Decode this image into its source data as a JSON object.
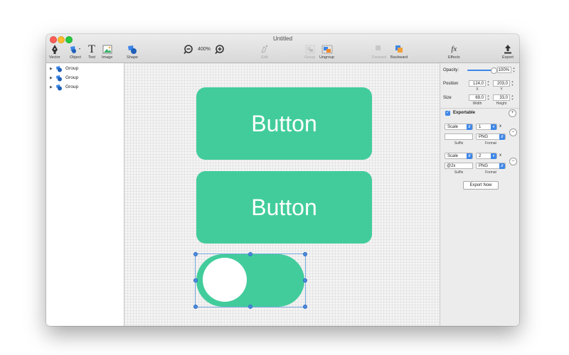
{
  "window": {
    "title": "Untitled"
  },
  "toolbar": {
    "vector": "Vector",
    "object": "Object",
    "text": "Text",
    "image": "Image",
    "shape": "Shape",
    "zoom_level": "400%",
    "edit": "Edit",
    "group": "Group",
    "ungroup": "Ungroup",
    "forward": "Forward",
    "backward": "Backward",
    "effects": "Effects",
    "export": "Export",
    "text_glyph": "T",
    "effects_glyph": "fx"
  },
  "layers": [
    {
      "label": "Group"
    },
    {
      "label": "Group"
    },
    {
      "label": "Group"
    }
  ],
  "canvas": {
    "button1_text": "Button",
    "button2_text": "Button"
  },
  "inspector": {
    "opacity_label": "Opacity:",
    "opacity_value": "100%",
    "opacity_fraction": 1.0,
    "position_label": "Position",
    "position_x": "124,0",
    "position_y": "203,0",
    "x_label": "X",
    "y_label": "Y",
    "size_label": "Size",
    "width_value": "69,0",
    "height_value": "33,0",
    "width_label": "Width",
    "height_label": "Height",
    "exportable_label": "Exportable",
    "exports": [
      {
        "mode": "Scale",
        "value": "1",
        "times": "x",
        "suffix": "",
        "format": "PNG"
      },
      {
        "mode": "Scale",
        "value": "2",
        "times": "x",
        "suffix": "@2x",
        "format": "PNG"
      }
    ],
    "suffix_label": "Suffix",
    "format_label": "Format",
    "export_now": "Export Now"
  },
  "colors": {
    "shape_fill": "#42cc9c",
    "selection": "#4a8be0",
    "accent": "#3d86e8"
  }
}
